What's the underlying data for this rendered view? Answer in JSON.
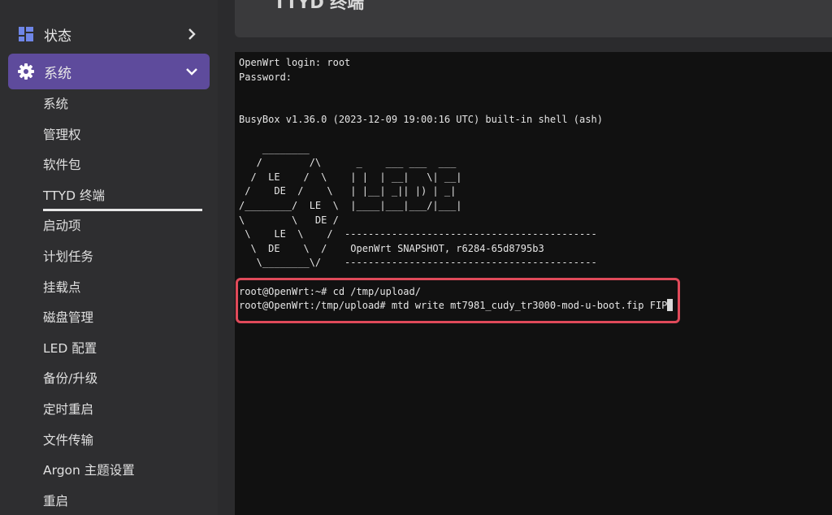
{
  "sidebar": {
    "status_label": "状态",
    "system_label": "系统",
    "items": [
      {
        "label": "系统"
      },
      {
        "label": "管理权"
      },
      {
        "label": "软件包"
      },
      {
        "label": "TTYD 终端"
      },
      {
        "label": "启动项"
      },
      {
        "label": "计划任务"
      },
      {
        "label": "挂载点"
      },
      {
        "label": "磁盘管理"
      },
      {
        "label": "LED 配置"
      },
      {
        "label": "备份/升级"
      },
      {
        "label": "定时重启"
      },
      {
        "label": "文件传输"
      },
      {
        "label": "Argon 主题设置"
      },
      {
        "label": "重启"
      }
    ],
    "active_item": "TTYD 终端",
    "accent_color": "#5e4b9c"
  },
  "header": {
    "title": "TTYD 终端"
  },
  "terminal": {
    "lines": [
      "OpenWrt login: root",
      "Password:",
      "",
      "",
      "BusyBox v1.36.0 (2023-12-09 19:00:16 UTC) built-in shell (ash)",
      "",
      "    ________",
      "   /        /\\      _    ___ ___  ___",
      "  /  LE    /  \\    | |  | __|   \\| __|",
      " /    DE  /    \\   | |__| _|| |) | _|",
      "/________/  LE  \\  |____|___|___/|___|",
      "\\        \\   DE /",
      " \\    LE  \\    /  -------------------------------------------",
      "  \\  DE    \\  /    OpenWrt SNAPSHOT, r6284-65d8795b3",
      "   \\________\\/    -------------------------------------------",
      "",
      "root@OpenWrt:~# cd /tmp/upload/",
      "root@OpenWrt:/tmp/upload# mtd write mt7981_cudy_tr3000-mod-u-boot.fip FIP"
    ],
    "highlight_color": "#e04a5a"
  }
}
